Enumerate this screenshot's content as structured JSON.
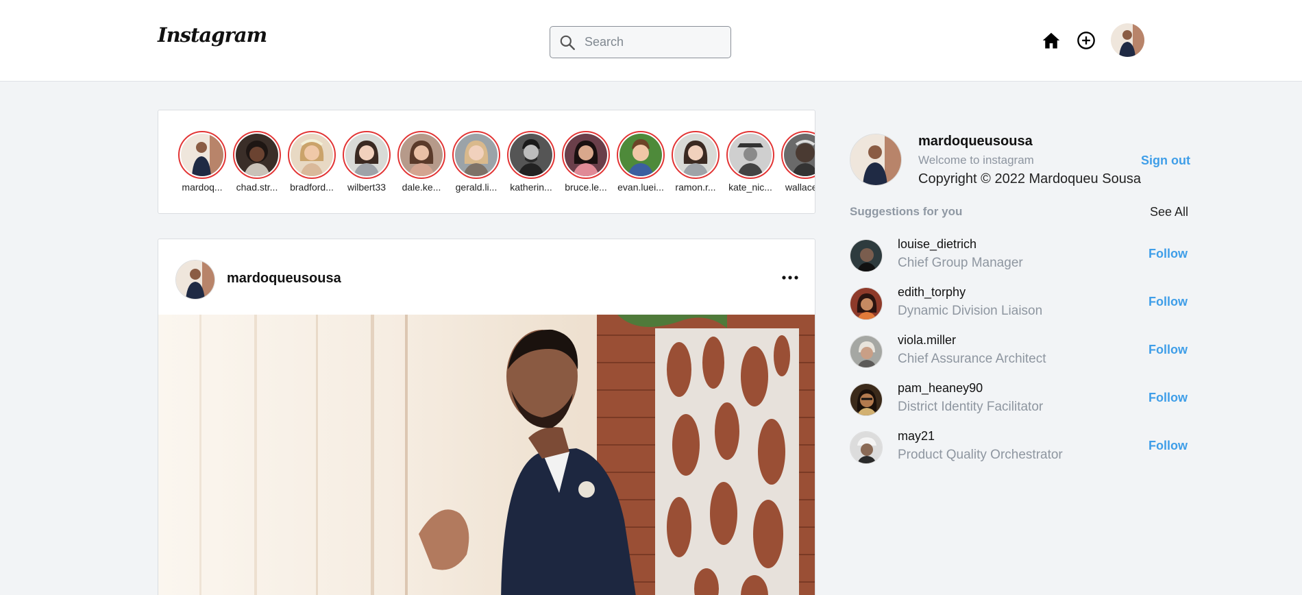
{
  "header": {
    "logo": "Instagram",
    "search_placeholder": "Search"
  },
  "stories": [
    {
      "name": "mardoq..."
    },
    {
      "name": "chad.str..."
    },
    {
      "name": "bradford..."
    },
    {
      "name": "wilbert33"
    },
    {
      "name": "dale.ke..."
    },
    {
      "name": "gerald.li..."
    },
    {
      "name": "katherin..."
    },
    {
      "name": "bruce.le..."
    },
    {
      "name": "evan.luei..."
    },
    {
      "name": "ramon.r..."
    },
    {
      "name": "kate_nic..."
    },
    {
      "name": "wallace..."
    }
  ],
  "post": {
    "username": "mardoqueusousa"
  },
  "sidebar": {
    "username": "mardoqueusousa",
    "welcome": "Welcome to instagram",
    "copyright": "Copyright © 2022 Mardoqueu Sousa",
    "signout_label": "Sign out",
    "suggestions_title": "Suggestions for you",
    "see_all_label": "See All",
    "suggestions": [
      {
        "username": "louise_dietrich",
        "role": "Chief Group Manager",
        "follow": "Follow"
      },
      {
        "username": "edith_torphy",
        "role": "Dynamic Division Liaison",
        "follow": "Follow"
      },
      {
        "username": "viola.miller",
        "role": "Chief Assurance Architect",
        "follow": "Follow"
      },
      {
        "username": "pam_heaney90",
        "role": "District Identity Facilitator",
        "follow": "Follow"
      },
      {
        "username": "may21",
        "role": "Product Quality Orchestrator",
        "follow": "Follow"
      }
    ]
  },
  "colors": {
    "accent": "#3f9ee8",
    "story_ring": "#e23434",
    "background": "#f2f4f6"
  }
}
